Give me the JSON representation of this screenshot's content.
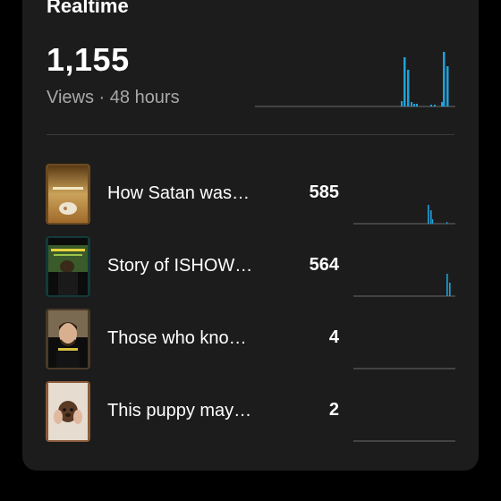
{
  "card": {
    "title": "Realtime",
    "views_value": "1,155",
    "views_label": "Views · 48 hours"
  },
  "colors": {
    "background": "#000000",
    "card": "#1c1c1c",
    "accent": "#1ea1db",
    "baseline": "#6a6a6a",
    "muted_text": "#a8a8a8"
  },
  "videos": [
    {
      "title": "How Satan was…",
      "views": "585",
      "thumbnail": "satan-video-thumbnail"
    },
    {
      "title": "Story of ISHOW…",
      "views": "564",
      "thumbnail": "ishow-video-thumbnail"
    },
    {
      "title": "Those who kno…",
      "views": "4",
      "thumbnail": "man-portrait-thumbnail"
    },
    {
      "title": "This puppy may…",
      "views": "2",
      "thumbnail": "puppy-thumbnail"
    }
  ]
}
